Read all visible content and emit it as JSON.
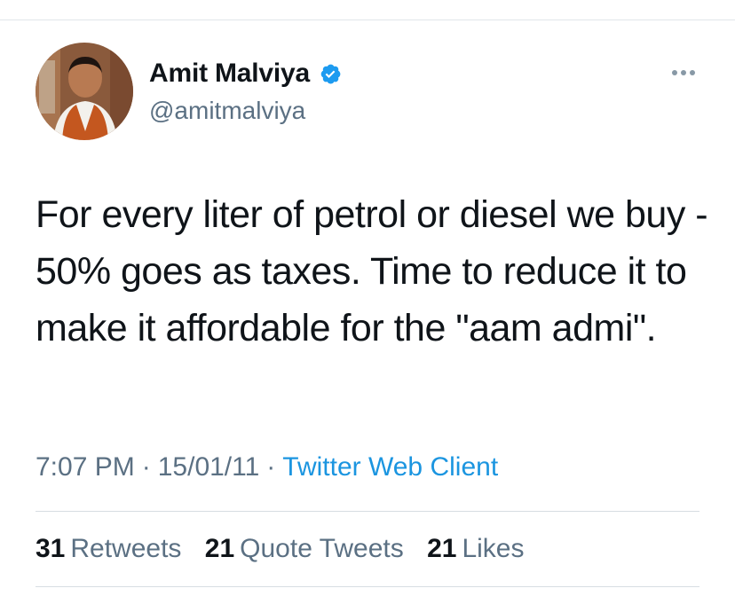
{
  "author": {
    "name": "Amit Malviya",
    "handle": "@amitmalviya",
    "verified": true
  },
  "icons": {
    "verified": "verified-badge-icon",
    "more": "more-options-icon"
  },
  "tweet": {
    "text": "For every liter of petrol or diesel we buy - 50% goes as taxes. Time to reduce it to make it affordable for the \"aam admi\"."
  },
  "meta": {
    "time": "7:07 PM",
    "separator": "·",
    "date": "15/01/11",
    "client": "Twitter Web Client"
  },
  "stats": {
    "retweets": {
      "count": "31",
      "label": "Retweets"
    },
    "quotes": {
      "count": "21",
      "label": "Quote Tweets"
    },
    "likes": {
      "count": "21",
      "label": "Likes"
    }
  },
  "colors": {
    "accent": "#1b95e0",
    "verified_blue": "#1d9bf0",
    "secondary_text": "#5b7083",
    "primary_text": "#0f1419",
    "divider": "#d7dde2"
  }
}
